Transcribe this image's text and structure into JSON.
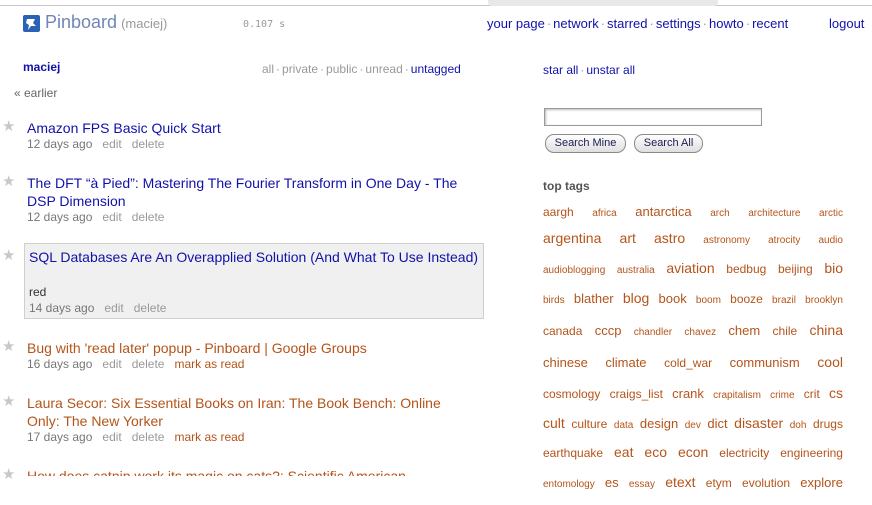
{
  "header": {
    "brand": "Pinboard",
    "user": "(maciej)",
    "timer": "0.107 s",
    "nav": [
      "your page",
      "network",
      "starred",
      "settings",
      "howto",
      "recent"
    ],
    "nav_sep": "·",
    "logout": "logout"
  },
  "left": {
    "username": "maciej",
    "filters": [
      "all",
      "private",
      "public",
      "unread",
      "untagged"
    ],
    "active_filter": "untagged",
    "earlier": "« earlier"
  },
  "bookmarks": [
    {
      "title": "Amazon FPS Basic Quick Start",
      "when": "12 days ago",
      "actions": [
        "edit",
        "delete"
      ],
      "unread": false
    },
    {
      "title": "The DFT “à Pied”: Mastering The Fourier Transform in One Day - The DSP Dimension",
      "when": "12 days ago",
      "actions": [
        "edit",
        "delete"
      ],
      "unread": false
    },
    {
      "title": "SQL Databases Are An Overapplied Solution (And What To Use Instead)",
      "tags": "red",
      "when": "14 days ago",
      "actions": [
        "edit",
        "delete"
      ],
      "unread": false
    },
    {
      "title": "Bug with 'read later' popup - Pinboard | Google Groups",
      "when": "16 days ago",
      "actions": [
        "edit",
        "delete",
        "mark as read"
      ],
      "unread": true
    },
    {
      "title": "Laura Secor: Six Essential Books on Iran: The Book Bench: Online Only: The New Yorker",
      "when": "17 days ago",
      "actions": [
        "edit",
        "delete",
        "mark as read"
      ],
      "unread": true
    },
    {
      "title": "How does catnip work its magic on cats?: Scientific American",
      "unread": true
    }
  ],
  "right": {
    "star_all": "star all",
    "unstar_all": "unstar all",
    "search_value": "",
    "search_mine": "Search Mine",
    "search_all": "Search All",
    "top_tags_label": "top tags",
    "tag_rows": [
      [
        [
          "aargh",
          2
        ],
        [
          "africa",
          1
        ],
        [
          "antarctica",
          3
        ],
        [
          "arch",
          1
        ],
        [
          "architecture",
          1
        ],
        [
          "arctic",
          1
        ]
      ],
      [
        [
          "argentina",
          4
        ],
        [
          "art",
          4
        ],
        [
          "astro",
          4
        ],
        [
          "astronomy",
          1
        ],
        [
          "atrocity",
          1
        ],
        [
          "audio",
          1
        ]
      ],
      [
        [
          "audioblogging",
          1
        ],
        [
          "australia",
          1
        ],
        [
          "aviation",
          4
        ],
        [
          "bedbug",
          2
        ],
        [
          "beijing",
          2
        ],
        [
          "bio",
          4
        ]
      ],
      [
        [
          "birds",
          1
        ],
        [
          "blather",
          3
        ],
        [
          "blog",
          4
        ],
        [
          "book",
          3
        ],
        [
          "boom",
          1
        ],
        [
          "booze",
          2
        ],
        [
          "brazil",
          1
        ],
        [
          "brooklyn",
          1
        ]
      ],
      [
        [
          "canada",
          2
        ],
        [
          "cccp",
          3
        ],
        [
          "chandler",
          1
        ],
        [
          "chavez",
          1
        ],
        [
          "chem",
          3
        ],
        [
          "chile",
          2
        ],
        [
          "china",
          4
        ]
      ],
      [
        [
          "chinese",
          3
        ],
        [
          "climate",
          3
        ],
        [
          "cold_war",
          2
        ],
        [
          "communism",
          3
        ],
        [
          "cool",
          4
        ]
      ],
      [
        [
          "cosmology",
          2
        ],
        [
          "craigs_list",
          2
        ],
        [
          "crank",
          3
        ],
        [
          "crapitalism",
          1
        ],
        [
          "crime",
          1
        ],
        [
          "crit",
          2
        ],
        [
          "cs",
          4
        ]
      ],
      [
        [
          "cult",
          4
        ],
        [
          "culture",
          2
        ],
        [
          "data",
          1
        ],
        [
          "design",
          3
        ],
        [
          "dev",
          1
        ],
        [
          "dict",
          3
        ],
        [
          "disaster",
          4
        ],
        [
          "doh",
          1
        ],
        [
          "drugs",
          2
        ]
      ],
      [
        [
          "earthquake",
          2
        ],
        [
          "eat",
          4
        ],
        [
          "eco",
          4
        ],
        [
          "econ",
          4
        ],
        [
          "electricity",
          2
        ],
        [
          "engineering",
          2
        ]
      ],
      [
        [
          "entomology",
          1
        ],
        [
          "es",
          3
        ],
        [
          "essay",
          1
        ],
        [
          "etext",
          4
        ],
        [
          "etym",
          2
        ],
        [
          "evolution",
          2
        ],
        [
          "explore",
          3
        ]
      ]
    ]
  },
  "colors": {
    "link": "#1111aa",
    "unread": "#b5541a",
    "tag": "#b5541a",
    "muted": "#999999",
    "brand": "#6f86b6"
  }
}
